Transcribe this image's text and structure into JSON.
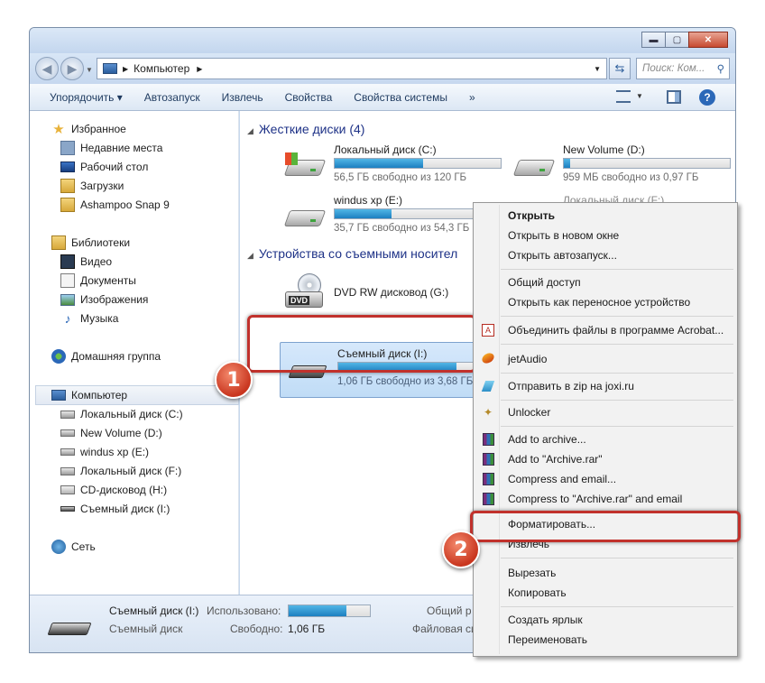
{
  "window": {
    "controls": {
      "minimize": "▬",
      "maximize": "▢",
      "close": "✕"
    },
    "address": {
      "path_label": "Компьютер",
      "search_placeholder": "Поиск: Ком..."
    },
    "toolbar": {
      "organize": "Упорядочить ▾",
      "autoplay": "Автозапуск",
      "eject": "Извлечь",
      "properties": "Свойства",
      "system_properties": "Свойства системы",
      "more": "»"
    }
  },
  "sidebar": {
    "favorites": {
      "label": "Избранное",
      "items": [
        "Недавние места",
        "Рабочий стол",
        "Загрузки",
        "Ashampoo Snap 9"
      ]
    },
    "libraries": {
      "label": "Библиотеки",
      "items": [
        "Видео",
        "Документы",
        "Изображения",
        "Музыка"
      ]
    },
    "homegroup": "Домашняя группа",
    "computer": {
      "label": "Компьютер",
      "items": [
        "Локальный диск (C:)",
        "New Volume (D:)",
        "windus xp (E:)",
        "Локальный диск (F:)",
        "CD-дисковод (H:)",
        "Съемный диск (I:)"
      ]
    },
    "network": "Сеть"
  },
  "main": {
    "hard_drives_header": "Жесткие диски (4)",
    "removable_header": "Устройства со съемными носител",
    "drives": [
      {
        "name": "Локальный диск (C:)",
        "free": "56,5 ГБ свободно из 120 ГБ",
        "used_fraction": 0.53
      },
      {
        "name": "New Volume (D:)",
        "free": "959 МБ свободно из 0,97 ГБ",
        "used_fraction": 0.04
      },
      {
        "name": "windus xp (E:)",
        "free": "35,7 ГБ свободно из 54,3 ГБ",
        "used_fraction": 0.34
      },
      {
        "name": "Локальный диск (F:)",
        "free": "",
        "used_fraction": 0
      }
    ],
    "dvd": {
      "name": "DVD RW дисковод (G:)",
      "icon_label": "DVD"
    },
    "removable": {
      "name": "Съемный диск (I:)",
      "free": "1,06 ГБ свободно из 3,68 ГБ",
      "used_fraction": 0.71
    }
  },
  "status": {
    "name": "Съемный диск (I:)",
    "type": "Съемный диск",
    "used_label": "Использовано:",
    "free_label": "Свободно:",
    "free_value": "1,06 ГБ",
    "total_label": "Общий р",
    "fs_label": "Файловая си",
    "used_fraction": 0.71
  },
  "context_menu": {
    "open": "Открыть",
    "open_new_window": "Открыть в новом окне",
    "open_autoplay": "Открыть автозапуск...",
    "sharing": "Общий доступ",
    "open_portable": "Открыть как переносное устройство",
    "acrobat": "Объединить файлы в программе Acrobat...",
    "jetaudio": "jetAudio",
    "joxi": "Отправить в zip на joxi.ru",
    "unlocker": "Unlocker",
    "add_archive": "Add to archive...",
    "add_archive_rar": "Add to \"Archive.rar\"",
    "compress_email": "Compress and email...",
    "compress_rar_email": "Compress to \"Archive.rar\" and email",
    "format": "Форматировать...",
    "eject": "Извлечь",
    "cut": "Вырезать",
    "copy": "Копировать",
    "shortcut": "Создать ярлык",
    "rename": "Переименовать"
  },
  "callouts": {
    "first": "1",
    "second": "2"
  },
  "colors": {
    "accent_red": "#c1312c",
    "bar_fill": "#2a93d5",
    "link_blue": "#1e3287"
  }
}
